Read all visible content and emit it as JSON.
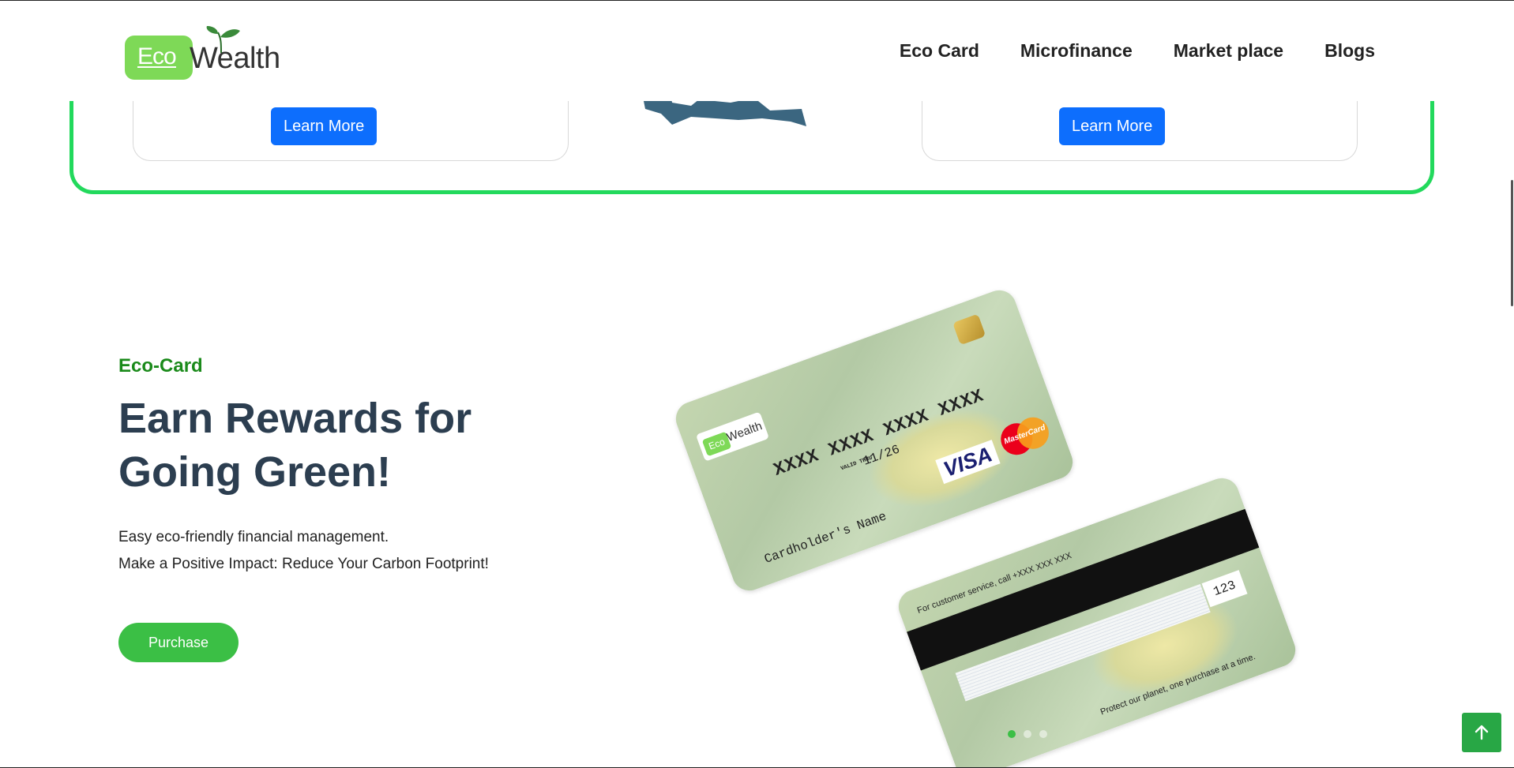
{
  "brand": {
    "eco": "Eco",
    "wealth": "Wealth"
  },
  "nav": [
    {
      "label": "Eco Card"
    },
    {
      "label": "Microfinance"
    },
    {
      "label": "Market place"
    },
    {
      "label": "Blogs"
    }
  ],
  "previous_section": {
    "left_card_button": "Learn More",
    "right_card_button": "Learn More"
  },
  "hero": {
    "eyebrow": "Eco-Card",
    "headline": "Earn Rewards for Going Green!",
    "description_line1": "Easy eco-friendly financial management.",
    "description_line2": "Make a Positive Impact: Reduce Your Carbon Footprint!",
    "purchase_button": "Purchase"
  },
  "card_front": {
    "logo_eco": "Eco",
    "logo_wealth": "Wealth",
    "number": "XXXX XXXX XXXX XXXX",
    "valid_label": "VALID THRU",
    "valid_date": "11/26",
    "cardholder": "Cardholder's Name",
    "network1": "VISA",
    "network2": "MasterCard"
  },
  "card_back": {
    "service": "For customer service, call +XXX XXX XXX",
    "cvv": "123",
    "tagline": "Protect our planet, one purchase at a time."
  },
  "carousel": {
    "slides": 3,
    "active": 1
  },
  "icons": {
    "scroll_top": "arrow-up-icon"
  },
  "colors": {
    "accent_green": "#3bbf45",
    "frame_green": "#22d95c",
    "button_blue": "#0d6efd",
    "headline": "#2c3e50"
  }
}
